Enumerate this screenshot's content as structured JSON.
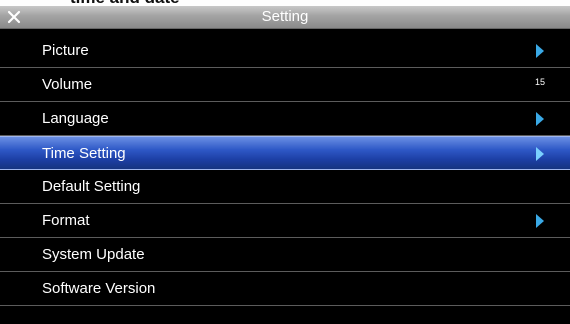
{
  "caption": "time and date",
  "header": {
    "title": "Setting",
    "close_icon": "close-icon"
  },
  "menu": {
    "selected_index": 3,
    "items": [
      {
        "label": "Picture",
        "has_arrow": true,
        "value": ""
      },
      {
        "label": "Volume",
        "has_arrow": false,
        "value": "15"
      },
      {
        "label": "Language",
        "has_arrow": true,
        "value": ""
      },
      {
        "label": "Time Setting",
        "has_arrow": true,
        "value": ""
      },
      {
        "label": "Default Setting",
        "has_arrow": false,
        "value": ""
      },
      {
        "label": "Format",
        "has_arrow": true,
        "value": ""
      },
      {
        "label": "System Update",
        "has_arrow": false,
        "value": ""
      },
      {
        "label": "Software Version",
        "has_arrow": false,
        "value": ""
      }
    ]
  },
  "colors": {
    "highlight": "#2e58c6",
    "arrow": "#3aa9e6",
    "titlebar": "#a3a3a3"
  }
}
